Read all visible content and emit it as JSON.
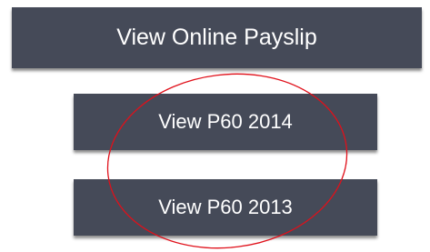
{
  "buttons": {
    "online_payslip": "View Online Payslip",
    "p60_2014": "View P60 2014",
    "p60_2013": "View P60 2013"
  },
  "colors": {
    "button_bg": "#454a58",
    "button_text": "#ffffff",
    "annotation_circle": "#e0101a"
  }
}
